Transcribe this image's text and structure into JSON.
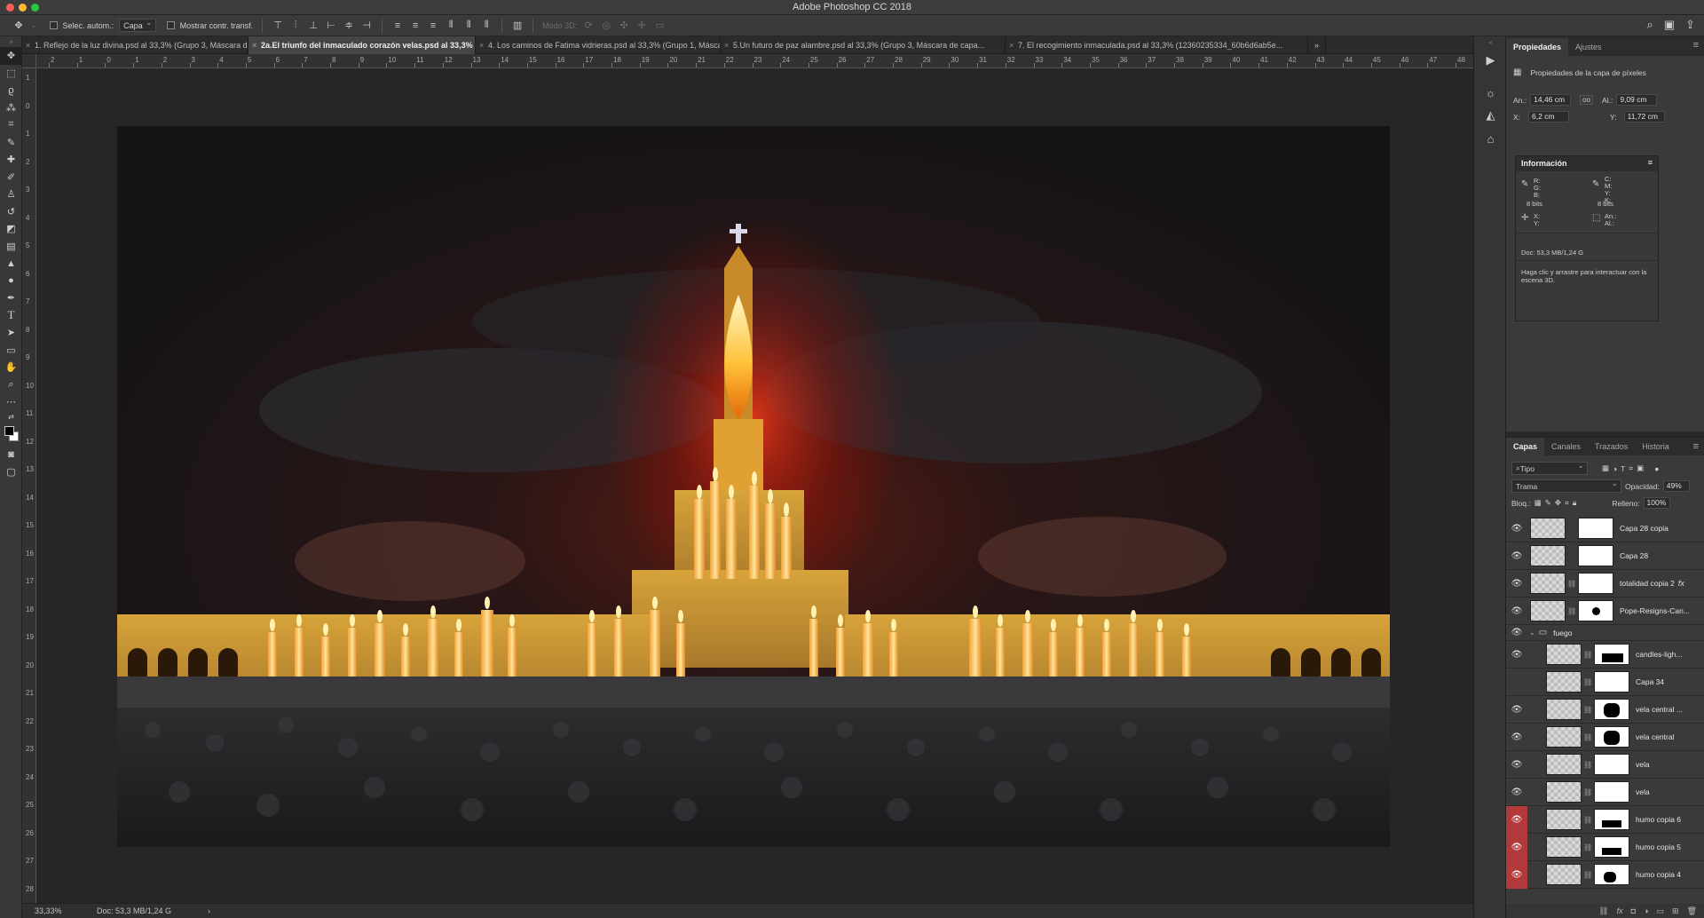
{
  "app": {
    "title": "Adobe Photoshop CC 2018",
    "traffic_colors": [
      "#fc5f57",
      "#fdbc2e",
      "#28c840"
    ]
  },
  "options_bar": {
    "auto_select_label": "Selec. autom.:",
    "auto_select_value": "Capa",
    "show_transform_label": "Mostrar contr. transf.",
    "mode3d_label": "Modo 3D:"
  },
  "doc_tabs": [
    {
      "label": "1. Reflejo de la luz divina.psd al 33,3% (Grupo 3, Máscara de capa..."
    },
    {
      "label": "2a.El triunfo del inmaculado corazón velas.psd al 33,3% (RGB/8*)"
    },
    {
      "label": "4. Los caminos de Fatima vidrieras.psd al 33,3% (Grupo 1, Máscara de c..."
    },
    {
      "label": "5.Un futuro de paz alambre.psd al 33,3% (Grupo 3, Máscara de capa..."
    },
    {
      "label": "7. El recogimiento inmaculada.psd al 33,3% (12360235334_60b6d6ab5e..."
    }
  ],
  "ruler_h": [
    "2",
    "1",
    "0",
    "1",
    "2",
    "3",
    "4",
    "5",
    "6",
    "7",
    "8",
    "9",
    "10",
    "11",
    "12",
    "13",
    "14",
    "15",
    "16",
    "17",
    "18",
    "19",
    "20",
    "21",
    "22",
    "23",
    "24",
    "25",
    "26",
    "27",
    "28",
    "29",
    "30",
    "31",
    "32",
    "33",
    "34",
    "35",
    "36",
    "37",
    "38",
    "39",
    "40",
    "41",
    "42",
    "43",
    "44",
    "45",
    "46",
    "47",
    "48"
  ],
  "ruler_v": [
    "1",
    "0",
    "1",
    "2",
    "3",
    "4",
    "5",
    "6",
    "7",
    "8",
    "9",
    "10",
    "11",
    "12",
    "13",
    "14",
    "15",
    "16",
    "17",
    "18",
    "19",
    "20",
    "21",
    "22",
    "23",
    "24",
    "25",
    "26",
    "27",
    "28"
  ],
  "status": {
    "zoom": "33,33%",
    "doc": "Doc: 53,3 MB/1,24 G"
  },
  "properties": {
    "tabs": [
      "Propiedades",
      "Ajustes"
    ],
    "heading": "Propiedades de la capa de píxeles",
    "an_label": "An.:",
    "an_value": "14,46 cm",
    "al_label": "Al.:",
    "al_value": "9,09 cm",
    "x_label": "X:",
    "x_value": "6,2 cm",
    "y_label": "Y:",
    "y_value": "11,72 cm"
  },
  "info": {
    "title": "Información",
    "rgb": "R:\nG:\nB:",
    "bits1": "8 bits",
    "cmyk": "C:\nM:\nY:\nK:",
    "bits2": "8 bits",
    "xy": "X:\nY:",
    "anal": "An.:\nAl.:",
    "doc": "Doc: 53,3 MB/1,24 G",
    "hint": "Haga clic y arrastre para interactuar con la escena 3D."
  },
  "layers": {
    "tabs": [
      "Capas",
      "Canales",
      "Trazados",
      "Historia"
    ],
    "filter": "Tipo",
    "blend_mode": "Trama",
    "opacity_label": "Opacidad:",
    "opacity_value": "49%",
    "lock_label": "Bloq.:",
    "fill_label": "Relleno:",
    "fill_value": "100%",
    "group_name": "fuego",
    "items": [
      {
        "name": "Capa 28 copia",
        "visible": true,
        "red": false,
        "fx": false
      },
      {
        "name": "Capa 28",
        "visible": true,
        "red": false,
        "fx": false
      },
      {
        "name": "totalidad copia 2",
        "visible": true,
        "red": false,
        "fx": true
      },
      {
        "name": "Pope-Resigns-Can...",
        "visible": true,
        "red": false,
        "fx": false
      },
      {
        "name": "candles-ligh...",
        "visible": true,
        "red": false,
        "fx": false
      },
      {
        "name": "Capa 34",
        "visible": false,
        "red": false,
        "fx": false
      },
      {
        "name": "vela central ...",
        "visible": true,
        "red": false,
        "fx": false
      },
      {
        "name": "vela central",
        "visible": true,
        "red": false,
        "fx": false
      },
      {
        "name": "vela",
        "visible": true,
        "red": false,
        "fx": false
      },
      {
        "name": "vela",
        "visible": true,
        "red": false,
        "fx": false
      },
      {
        "name": "humo copia 6",
        "visible": true,
        "red": true,
        "fx": false
      },
      {
        "name": "humo copia 5",
        "visible": true,
        "red": true,
        "fx": false
      },
      {
        "name": "humo copia 4",
        "visible": true,
        "red": true,
        "fx": false
      }
    ]
  }
}
